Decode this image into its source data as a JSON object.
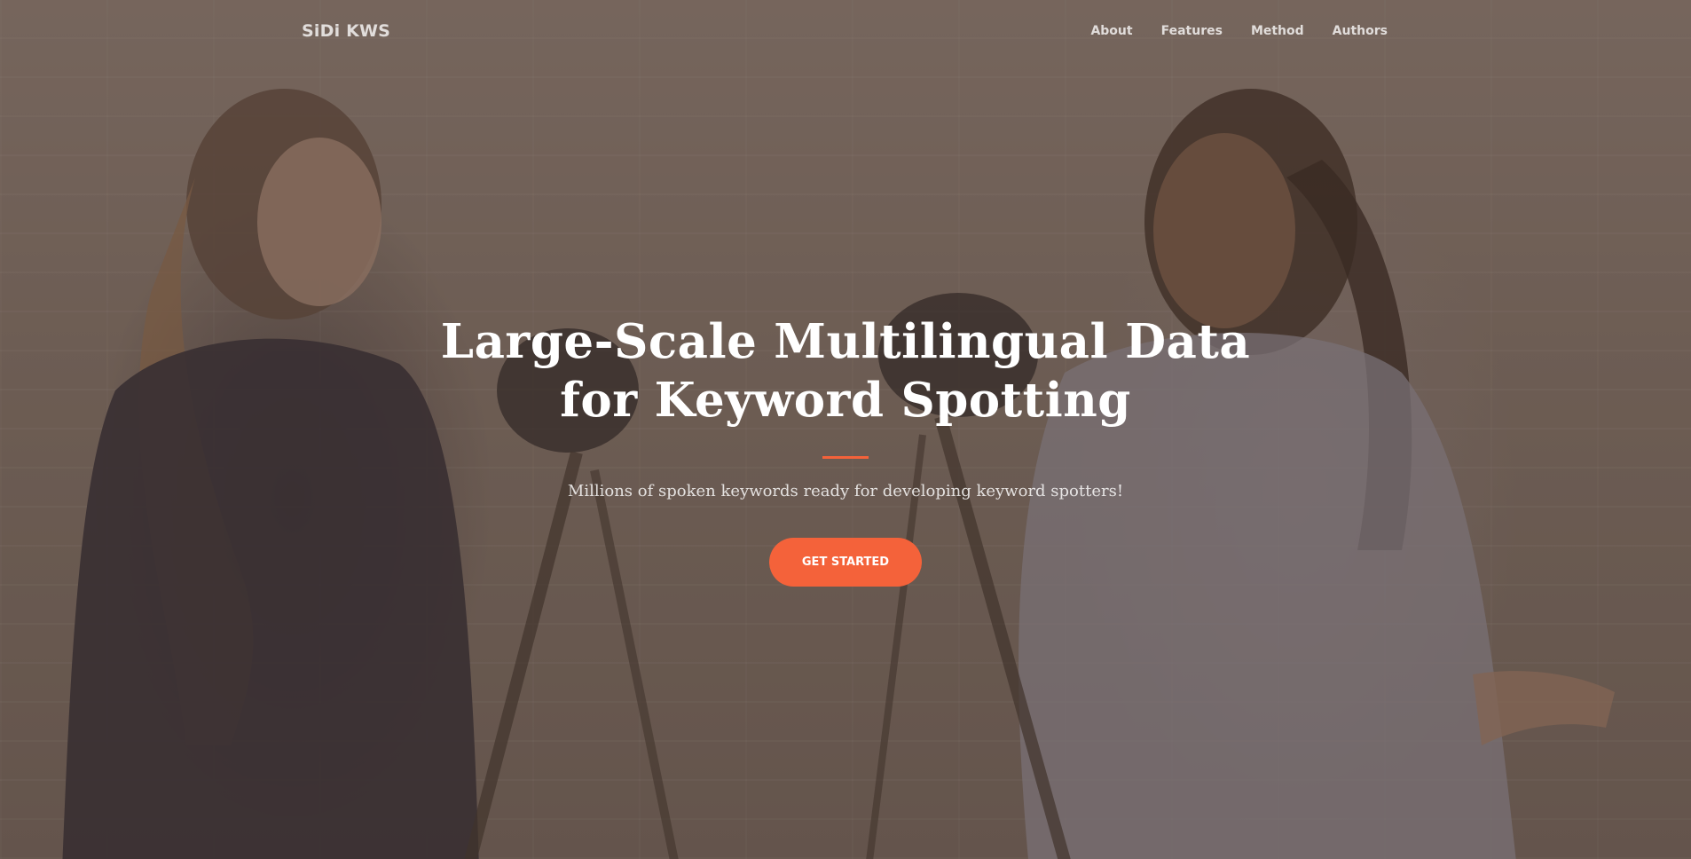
{
  "nav": {
    "brand": "SiDi KWS",
    "links": [
      {
        "label": "About"
      },
      {
        "label": "Features"
      },
      {
        "label": "Method"
      },
      {
        "label": "Authors"
      }
    ]
  },
  "hero": {
    "title_line1": "Large-Scale Multilingual Data",
    "title_line2": "for Keyword Spotting",
    "subtitle": "Millions of spoken keywords ready for developing keyword spotters!",
    "cta_label": "GET STARTED"
  },
  "colors": {
    "accent": "#f4623a",
    "text": "#ffffff"
  }
}
